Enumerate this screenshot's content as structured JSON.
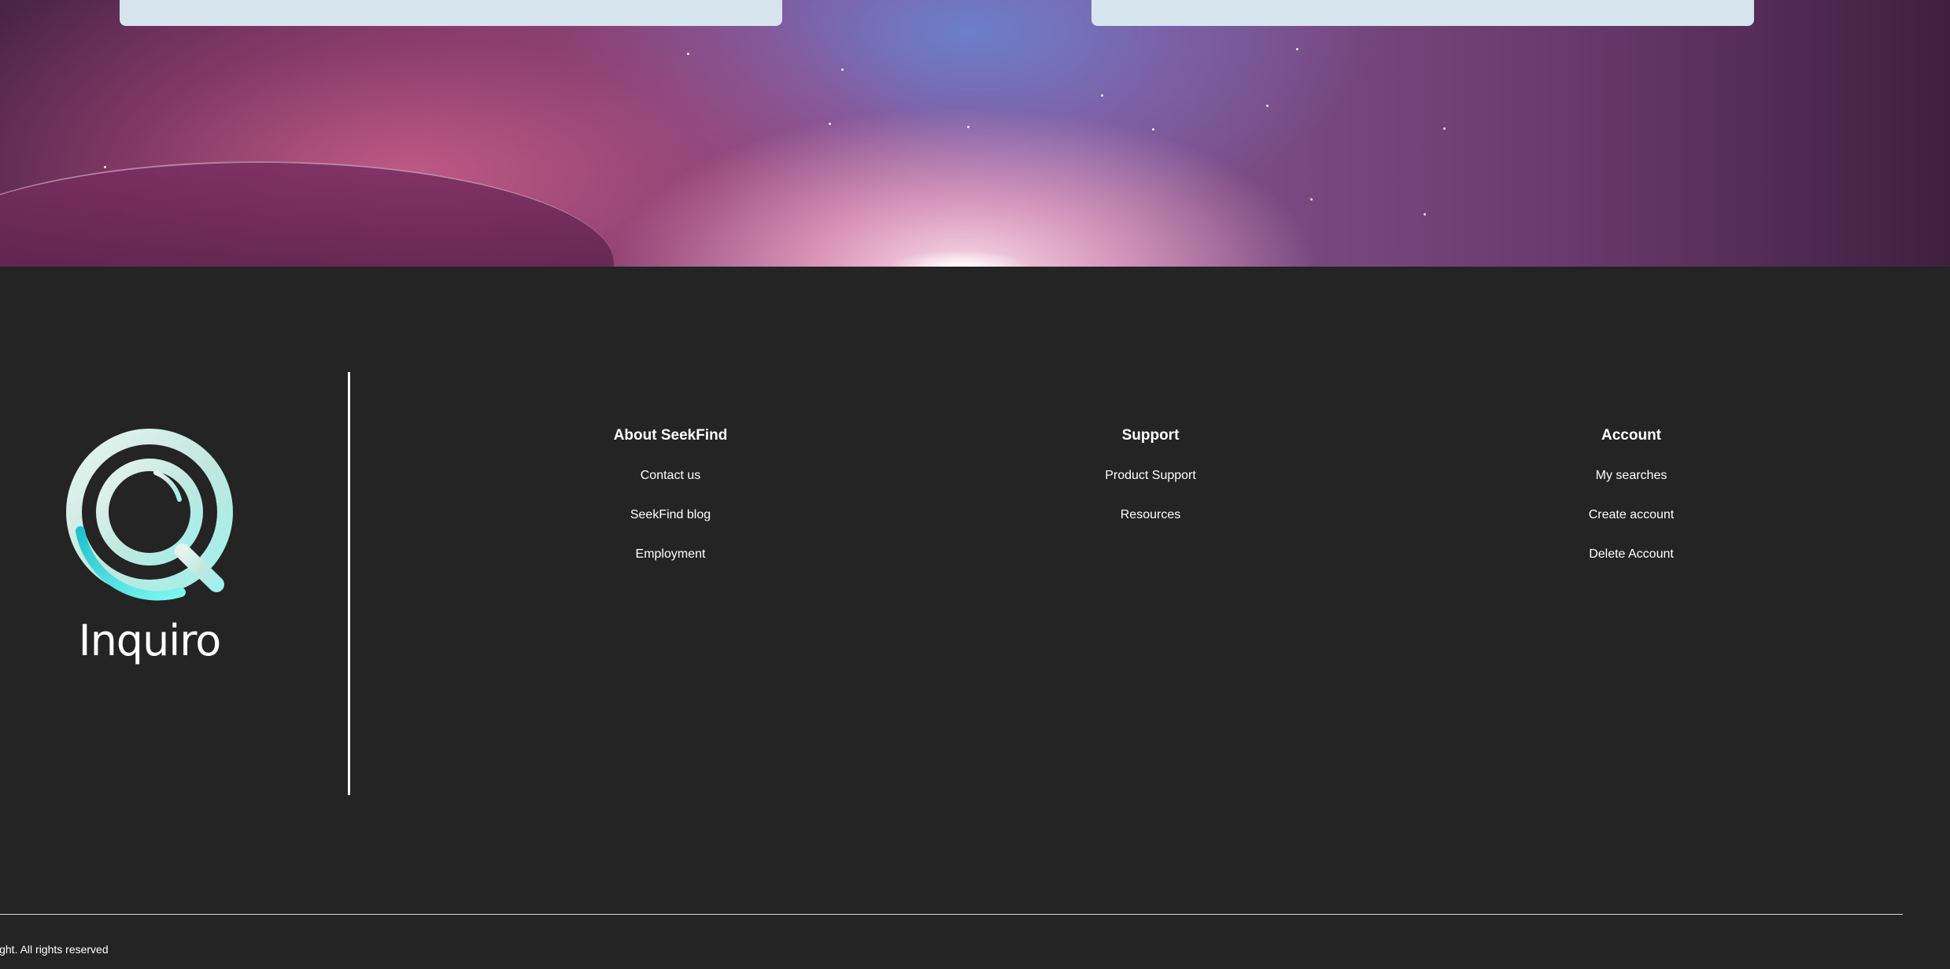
{
  "brand": {
    "name": "Inquiro"
  },
  "footer": {
    "columns": [
      {
        "title": "About SeekFind",
        "links": [
          "Contact us",
          "SeekFind blog",
          "Employment"
        ]
      },
      {
        "title": "Support",
        "links": [
          "Product Support",
          "Resources"
        ]
      },
      {
        "title": "Account",
        "links": [
          "My searches",
          "Create account",
          "Delete Account"
        ]
      }
    ],
    "copyright": "ight. All rights reserved"
  },
  "colors": {
    "footer_bg": "#242424",
    "card_bg": "#d6e4ee",
    "logo_accent": "#2fd4d8",
    "text": "#ffffff"
  }
}
